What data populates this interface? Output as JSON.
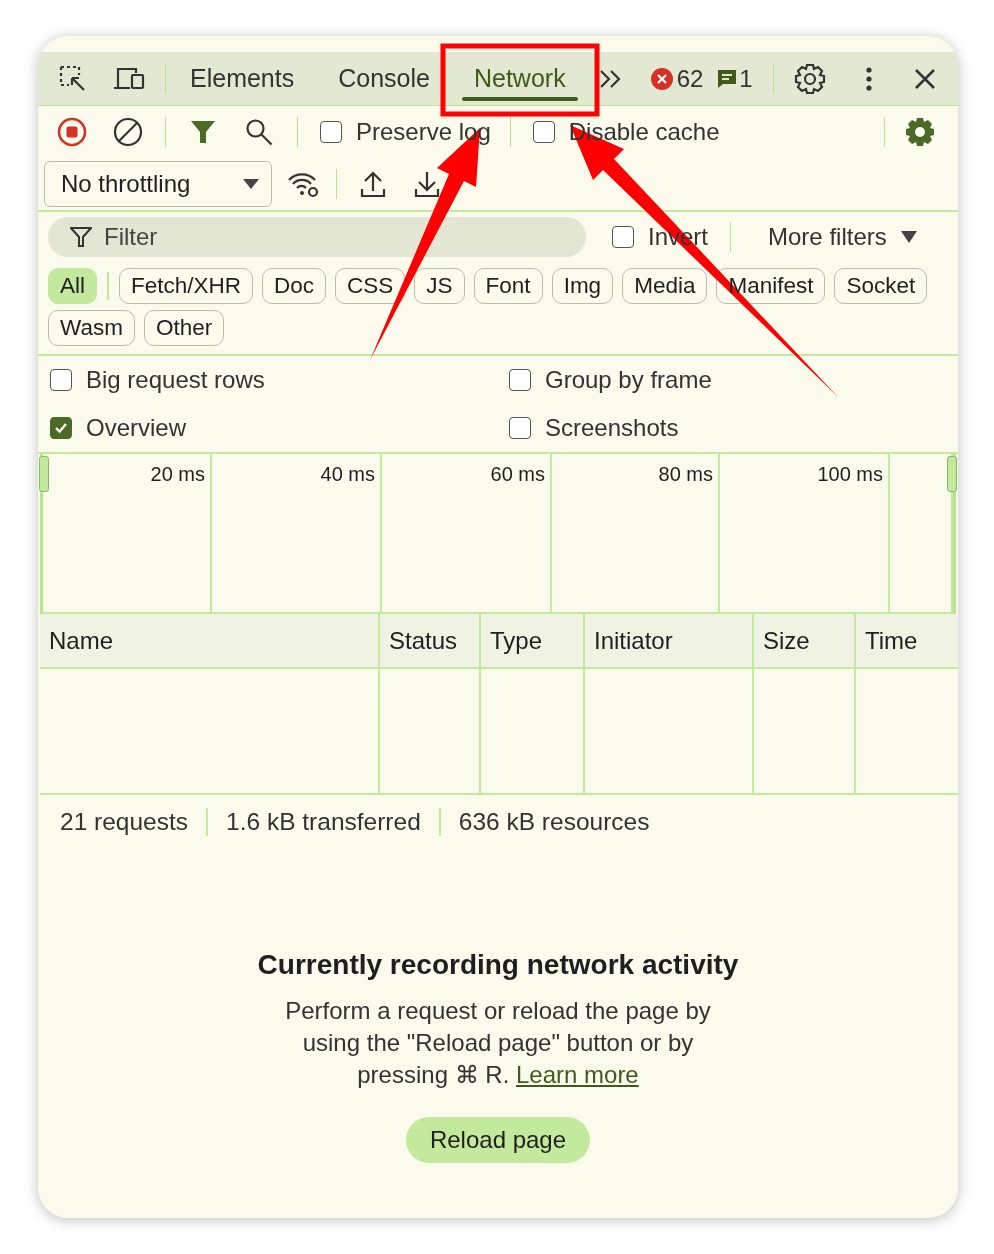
{
  "tabs": [
    {
      "label": "Elements",
      "selected": false
    },
    {
      "label": "Console",
      "selected": false
    },
    {
      "label": "Network",
      "selected": true
    }
  ],
  "error_count": "62",
  "message_count": "1",
  "toolbar": {
    "recording": true,
    "preserve_log": {
      "label": "Preserve log",
      "checked": false
    },
    "disable_cache": {
      "label": "Disable cache",
      "checked": false
    },
    "throttling": "No throttling"
  },
  "filter": {
    "placeholder": "Filter",
    "invert": {
      "label": "Invert",
      "checked": false
    },
    "more_filters": "More filters"
  },
  "type_filters": [
    {
      "label": "All",
      "selected": true
    },
    {
      "label": "Fetch/XHR",
      "selected": false
    },
    {
      "label": "Doc",
      "selected": false
    },
    {
      "label": "CSS",
      "selected": false
    },
    {
      "label": "JS",
      "selected": false
    },
    {
      "label": "Font",
      "selected": false
    },
    {
      "label": "Img",
      "selected": false
    },
    {
      "label": "Media",
      "selected": false
    },
    {
      "label": "Manifest",
      "selected": false
    },
    {
      "label": "Socket",
      "selected": false
    },
    {
      "label": "Wasm",
      "selected": false
    },
    {
      "label": "Other",
      "selected": false
    }
  ],
  "options": [
    {
      "label": "Big request rows",
      "checked": false
    },
    {
      "label": "Group by frame",
      "checked": false
    },
    {
      "label": "Overview",
      "checked": true
    },
    {
      "label": "Screenshots",
      "checked": false
    }
  ],
  "overview_ticks": [
    "20 ms",
    "40 ms",
    "60 ms",
    "80 ms",
    "100 ms"
  ],
  "table": {
    "columns": [
      "Name",
      "Status",
      "Type",
      "Initiator",
      "Size",
      "Time"
    ]
  },
  "status_bar": [
    "21 requests",
    "1.6 kB transferred",
    "636 kB resources"
  ],
  "empty_state": {
    "title": "Currently recording network activity",
    "text": "Perform a request or reload the page by using the \"Reload page\" button or by pressing ⌘ R.",
    "link": "Learn more",
    "button": "Reload page"
  }
}
